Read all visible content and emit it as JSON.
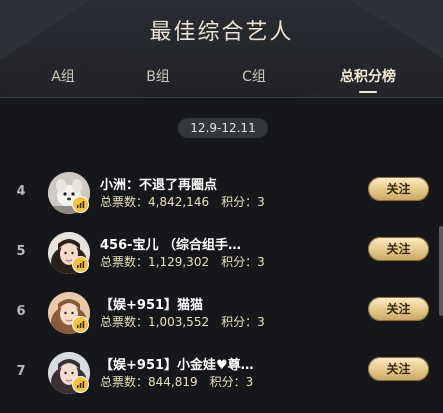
{
  "title": "最佳综合艺人",
  "tabs": [
    {
      "label": "A组",
      "active": false
    },
    {
      "label": "B组",
      "active": false
    },
    {
      "label": "C组",
      "active": false
    },
    {
      "label": "总积分榜",
      "active": true
    }
  ],
  "date_range": "12.9-12.11",
  "rows": [
    {
      "rank": "4",
      "name": "小洲：不退了再圈点",
      "votes_label": "总票数：",
      "votes": "4,842,146",
      "score_label": "积分：",
      "score": "3",
      "follow_label": "关注"
    },
    {
      "rank": "5",
      "name": "456-宝儿 （综合组手…",
      "votes_label": "总票数：",
      "votes": "1,129,302",
      "score_label": "积分：",
      "score": "3",
      "follow_label": "关注"
    },
    {
      "rank": "6",
      "name": "【娱+951】猫猫",
      "votes_label": "总票数：",
      "votes": "1,003,552",
      "score_label": "积分：",
      "score": "3",
      "follow_label": "关注"
    },
    {
      "rank": "7",
      "name": "【娱+951】小金娃♥尊…",
      "votes_label": "总票数：",
      "votes": "844,819",
      "score_label": "积分：",
      "score": "3",
      "follow_label": "关注"
    }
  ],
  "colors": {
    "background": "#16171b",
    "header": "#26282e",
    "title": "#e9e2cf",
    "stats": "#e8e0b8",
    "follow_button": "#e9cf93",
    "badge": "#f3c33c"
  },
  "icons": {
    "badge": "signal-bars-icon"
  }
}
